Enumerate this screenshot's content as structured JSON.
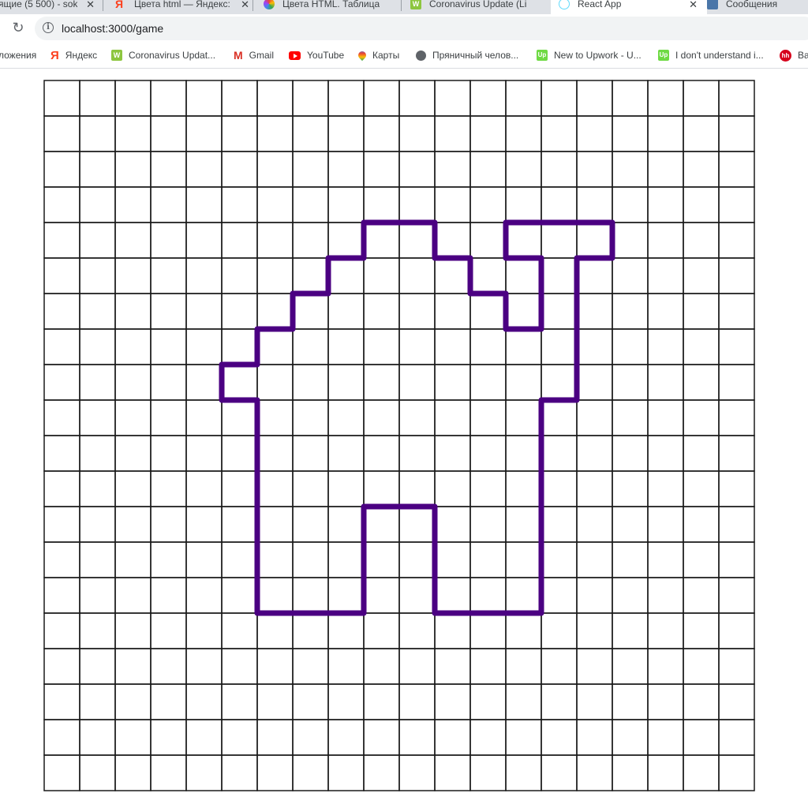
{
  "browser": {
    "tabs": [
      {
        "title": "ящие (5 500) - sok",
        "icon": "mail-icon",
        "active": false
      },
      {
        "title": "Цвета html — Яндекс:",
        "icon": "yandex-icon",
        "active": false
      },
      {
        "title": "Цвета HTML. Таблица",
        "icon": "colorwheel-icon",
        "active": false
      },
      {
        "title": "Coronavirus Update (Li",
        "icon": "worldometer-icon",
        "active": false
      },
      {
        "title": "React App",
        "icon": "react-icon",
        "active": true
      },
      {
        "title": "Сообщения",
        "icon": "vk-icon",
        "active": false
      }
    ],
    "address": {
      "url": "localhost:3000/game"
    },
    "bookmarks": [
      {
        "label": "ложения",
        "icon": ""
      },
      {
        "label": "Яндекс",
        "icon": "yandex-icon"
      },
      {
        "label": "Coronavirus Updat...",
        "icon": "worldometer-icon"
      },
      {
        "label": "Gmail",
        "icon": "gmail-icon"
      },
      {
        "label": "YouTube",
        "icon": "youtube-icon"
      },
      {
        "label": "Карты",
        "icon": "maps-pin-icon"
      },
      {
        "label": "Пряничный челов...",
        "icon": "globe-icon"
      },
      {
        "label": "New to Upwork - U...",
        "icon": "upwork-icon"
      },
      {
        "label": "I don't understand i...",
        "icon": "upwork-icon"
      },
      {
        "label": "Ba",
        "icon": "hh-icon"
      }
    ]
  },
  "game": {
    "grid": {
      "cols": 20,
      "rows": 20
    },
    "colors": {
      "grid_line": "#1a1a1a",
      "figure_outline": "#4b0082",
      "background": "#ffffff"
    },
    "figure_main": [
      [
        9,
        4
      ],
      [
        11,
        4
      ],
      [
        11,
        5
      ],
      [
        12,
        5
      ],
      [
        12,
        6
      ],
      [
        13,
        6
      ],
      [
        13,
        7
      ],
      [
        14,
        7
      ],
      [
        14,
        5
      ],
      [
        13,
        5
      ],
      [
        13,
        4
      ],
      [
        16,
        4
      ],
      [
        16,
        5
      ],
      [
        15,
        5
      ],
      [
        15,
        9
      ],
      [
        14,
        9
      ],
      [
        14,
        15
      ],
      [
        11,
        15
      ],
      [
        11,
        12
      ],
      [
        9,
        12
      ],
      [
        9,
        15
      ],
      [
        6,
        15
      ],
      [
        6,
        9
      ],
      [
        5,
        9
      ],
      [
        5,
        8
      ],
      [
        6,
        8
      ],
      [
        6,
        7
      ],
      [
        7,
        7
      ],
      [
        7,
        6
      ],
      [
        8,
        6
      ],
      [
        8,
        5
      ],
      [
        9,
        5
      ]
    ]
  }
}
